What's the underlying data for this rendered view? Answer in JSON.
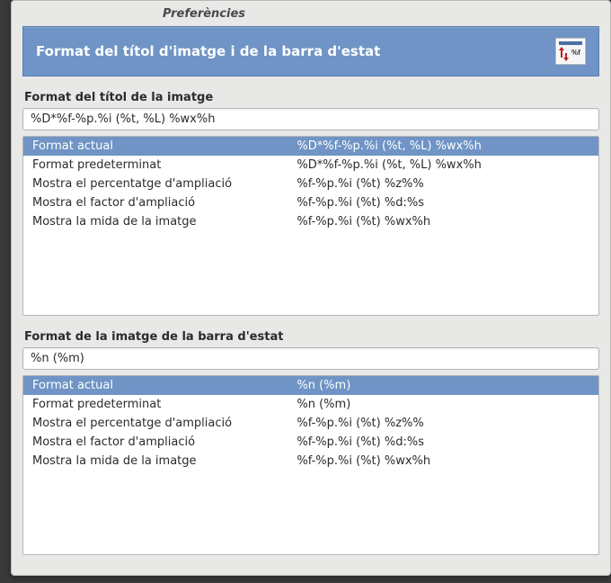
{
  "window": {
    "title": "Preferències"
  },
  "header": {
    "title": "Format del títol d'imatge i de la barra d'estat"
  },
  "section1": {
    "label": "Format del títol de la imatge",
    "input_value": "%D*%f-%p.%i (%t, %L) %wx%h",
    "rows": [
      {
        "label": "Format actual",
        "value": "%D*%f-%p.%i (%t, %L) %wx%h",
        "selected": true
      },
      {
        "label": "Format predeterminat",
        "value": "%D*%f-%p.%i (%t, %L) %wx%h",
        "selected": false
      },
      {
        "label": "Mostra el percentatge d'ampliació",
        "value": "%f-%p.%i (%t) %z%%",
        "selected": false
      },
      {
        "label": "Mostra el factor d'ampliació",
        "value": "%f-%p.%i (%t) %d:%s",
        "selected": false
      },
      {
        "label": "Mostra la mida de la imatge",
        "value": "%f-%p.%i (%t) %wx%h",
        "selected": false
      }
    ]
  },
  "section2": {
    "label": "Format de la imatge de la barra d'estat",
    "input_value": "%n (%m)",
    "rows": [
      {
        "label": "Format actual",
        "value": "%n (%m)",
        "selected": true
      },
      {
        "label": "Format predeterminat",
        "value": "%n (%m)",
        "selected": false
      },
      {
        "label": "Mostra el percentatge d'ampliació",
        "value": "%f-%p.%i (%t) %z%%",
        "selected": false
      },
      {
        "label": "Mostra el factor d'ampliació",
        "value": "%f-%p.%i (%t) %d:%s",
        "selected": false
      },
      {
        "label": "Mostra la mida de la imatge",
        "value": "%f-%p.%i (%t) %wx%h",
        "selected": false
      }
    ]
  }
}
